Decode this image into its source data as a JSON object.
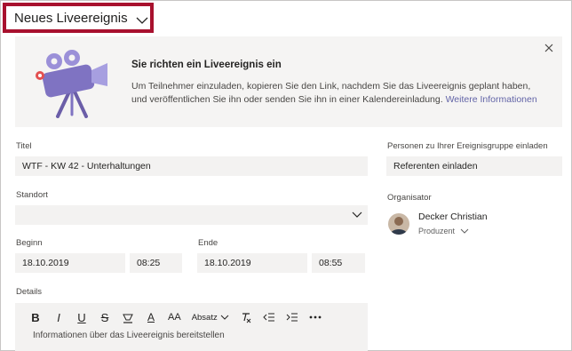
{
  "header": {
    "title": "Neues Liveereignis"
  },
  "banner": {
    "title": "Sie richten ein Liveereignis ein",
    "text": "Um Teilnehmer einzuladen, kopieren Sie den Link, nachdem Sie das Liveereignis geplant haben, und veröffentlichen Sie ihn oder senden Sie ihn in einer Kalendereinladung.",
    "link": "Weitere Informationen"
  },
  "form": {
    "title_label": "Titel",
    "title_value": "WTF - KW 42 - Unterhaltungen",
    "location_label": "Standort",
    "location_value": "",
    "start_label": "Beginn",
    "start_date": "18.10.2019",
    "start_time": "08:25",
    "end_label": "Ende",
    "end_date": "18.10.2019",
    "end_time": "08:55",
    "details_label": "Details",
    "details_placeholder": "Informationen über das Liveereignis bereitstellen"
  },
  "toolbar": {
    "paragraph_label": "Absatz"
  },
  "right": {
    "people_label": "Personen zu Ihrer Ereignisgruppe einladen",
    "people_placeholder": "Referenten einladen",
    "organizer_label": "Organisator",
    "organizer_name": "Decker Christian",
    "organizer_role": "Produzent"
  },
  "colors": {
    "accent": "#6264a7",
    "highlight_border": "#a8112e",
    "field_bg": "#f3f2f1",
    "banner_bg": "#f5f4f3"
  }
}
